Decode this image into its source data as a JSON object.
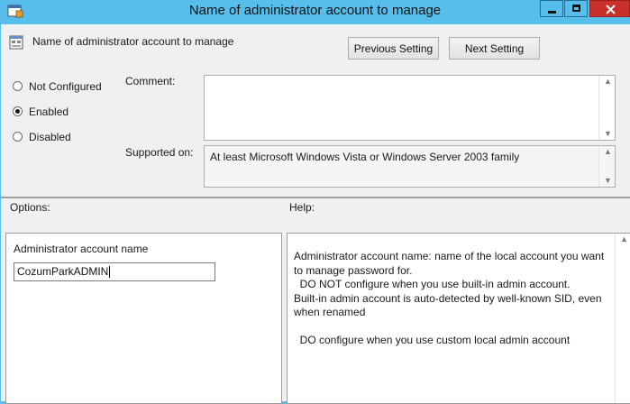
{
  "window": {
    "title": "Name of administrator account to manage",
    "accent_color": "#57bdea",
    "close_color": "#c7302b"
  },
  "header": {
    "policy_name": "Name of administrator account to manage",
    "previous_label": "Previous Setting",
    "next_label": "Next Setting"
  },
  "state": {
    "options": [
      {
        "label": "Not Configured",
        "selected": false
      },
      {
        "label": "Enabled",
        "selected": true
      },
      {
        "label": "Disabled",
        "selected": false
      }
    ]
  },
  "comment": {
    "label": "Comment:",
    "value": ""
  },
  "supported": {
    "label": "Supported on:",
    "value": "At least Microsoft Windows Vista or Windows Server 2003 family"
  },
  "options_panel": {
    "heading": "Options:",
    "field_label": "Administrator account name",
    "field_value": "CozumParkADMIN"
  },
  "help_panel": {
    "heading": "Help:",
    "lines": [
      "Administrator account name: name of the local account you want to manage password for.",
      "  DO NOT configure when you use built-in admin account.",
      "Built-in admin account is auto-detected by well-known SID, even when renamed",
      " ",
      "  DO configure when you use custom local admin account"
    ]
  },
  "icons": [
    "app-icon",
    "minimize-icon",
    "maximize-icon",
    "close-icon",
    "policy-icon",
    "scroll-up-icon",
    "scroll-down-icon"
  ]
}
